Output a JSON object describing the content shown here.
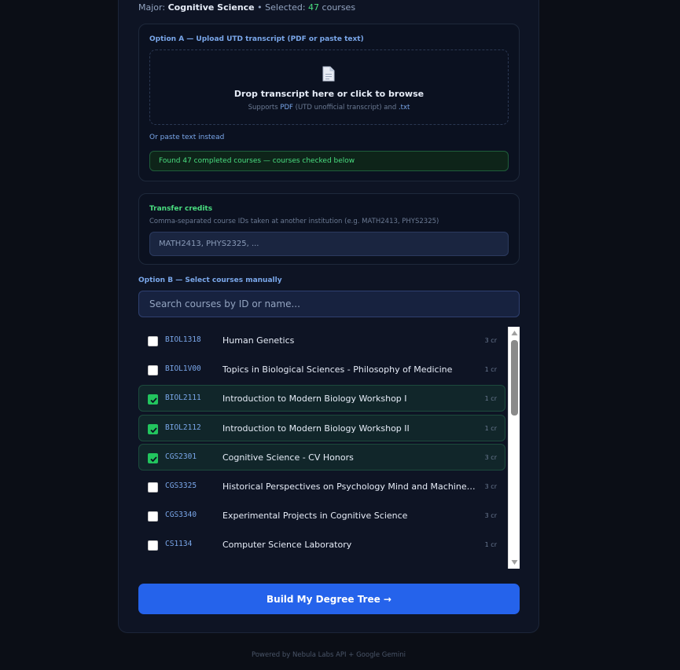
{
  "header": {
    "major_label": "Major:",
    "major_value": "Cognitive Science",
    "separator": "•",
    "selected_label": "Selected:",
    "selected_count": "47",
    "selected_unit": "courses"
  },
  "option_a": {
    "title": "Option A — Upload UTD transcript (PDF or paste text)",
    "drop_title": "Drop transcript here or click to browse",
    "drop_sub_prefix": "Supports",
    "drop_sub_pdf": "PDF",
    "drop_sub_middle": "(UTD unofficial transcript) and",
    "drop_sub_txt": ".txt",
    "paste_link": "Or paste text instead",
    "success_message": "Found 47 completed courses — courses checked below"
  },
  "transfer": {
    "title": "Transfer credits",
    "hint": "Comma-separated course IDs taken at another institution (e.g. MATH2413, PHYS2325)",
    "placeholder": "MATH2413, PHYS2325, ..."
  },
  "option_b": {
    "title": "Option B — Select courses manually",
    "search_placeholder": "Search courses by ID or name..."
  },
  "courses": [
    {
      "id": "BIOL1318",
      "name": "Human Genetics",
      "credits": "3 cr",
      "checked": false
    },
    {
      "id": "BIOL1V00",
      "name": "Topics in Biological Sciences - Philosophy of Medicine",
      "credits": "1 cr",
      "checked": false
    },
    {
      "id": "BIOL2111",
      "name": "Introduction to Modern Biology Workshop I",
      "credits": "1 cr",
      "checked": true
    },
    {
      "id": "BIOL2112",
      "name": "Introduction to Modern Biology Workshop II",
      "credits": "1 cr",
      "checked": true
    },
    {
      "id": "CGS2301",
      "name": "Cognitive Science - CV Honors",
      "credits": "3 cr",
      "checked": true
    },
    {
      "id": "CGS3325",
      "name": "Historical Perspectives on Psychology Mind and Machines since...",
      "credits": "3 cr",
      "checked": false
    },
    {
      "id": "CGS3340",
      "name": "Experimental Projects in Cognitive Science",
      "credits": "3 cr",
      "checked": false
    },
    {
      "id": "CS1134",
      "name": "Computer Science Laboratory",
      "credits": "1 cr",
      "checked": false
    }
  ],
  "build_button": "Build My Degree Tree →",
  "footer": "Powered by Nebula Labs API + Google Gemini",
  "colors": {
    "accent_blue": "#2563eb",
    "success_green": "#4ade80",
    "link_blue": "#7aa7ea"
  }
}
